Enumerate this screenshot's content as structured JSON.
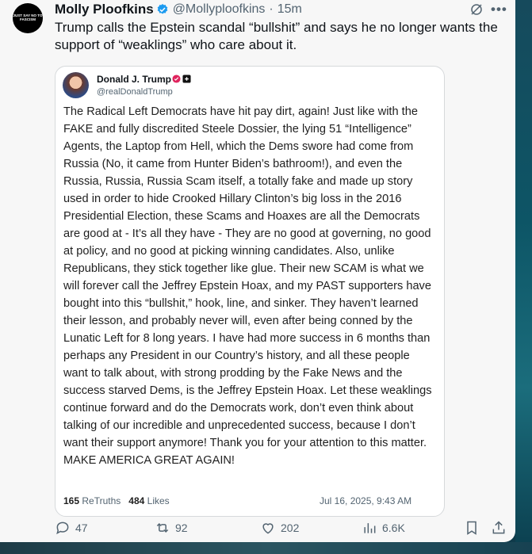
{
  "logo": {
    "text": "JUST SAY NO TO FASCISM"
  },
  "post": {
    "author_name": "Molly Ploofkins",
    "handle": "@Mollyploofkins",
    "separator": "·",
    "time": "15m",
    "text": "Trump calls the Epstein scandal “bullshit” and says he no longer wants the support of “weaklings” who care about it."
  },
  "quote": {
    "author_name": "Donald J. Trump",
    "handle": "@realDonaldTrump",
    "body": "The Radical Left Democrats have hit pay dirt, again! Just like with the FAKE and fully discredited Steele Dossier, the lying 51 “Intelligence” Agents, the Laptop from Hell, which the Dems swore had come from Russia (No, it came from Hunter Biden’s bathroom!), and even the Russia, Russia, Russia Scam itself, a totally fake and made up story used in order to hide Crooked Hillary Clinton’s big loss in the 2016 Presidential Election, these Scams and Hoaxes are all the Democrats are good at - It’s all they have - They are no good at governing, no good at policy, and no good at picking winning candidates. Also, unlike Republicans, they stick together like glue. Their new SCAM is what we will forever call the Jeffrey Epstein Hoax, and my PAST supporters have bought into this “bullshit,” hook, line, and sinker. They haven’t learned their lesson, and probably never will, even after being conned by the Lunatic Left for 8 long years. I have had more success in 6 months than perhaps any President in our Country’s history, and all these people want to talk about, with strong prodding by the Fake News and the success starved Dems, is the Jeffrey Epstein Hoax. Let these weaklings continue forward and do the Democrats work, don’t even think about talking of our incredible and unprecedented success, because I don’t want their support anymore! Thank you for your attention to this matter. MAKE AMERICA GREAT AGAIN!",
    "retruths_count": "165",
    "retruths_label": "ReTruths",
    "likes_count": "484",
    "likes_label": "Likes",
    "date": "Jul 16, 2025, 9:43 AM"
  },
  "actions": {
    "replies": "47",
    "reposts": "92",
    "likes": "202",
    "views": "6.6K"
  },
  "colors": {
    "verified_blue": "#1d9bf0",
    "text": "#0f1419",
    "muted": "#536471",
    "truth_badge": "#e0245e"
  }
}
